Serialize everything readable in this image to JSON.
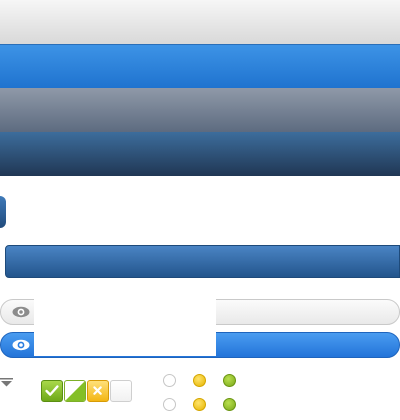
{
  "bars": [
    {
      "name": "light-toolbar"
    },
    {
      "name": "blue-toolbar"
    },
    {
      "name": "gray-toolbar"
    },
    {
      "name": "navy-toolbar"
    }
  ],
  "pills": [
    {
      "state": "default",
      "icon": "eye-icon"
    },
    {
      "state": "active",
      "icon": "eye-icon"
    }
  ],
  "checkboxes": [
    {
      "state": "checked",
      "color": "#7cbf24"
    },
    {
      "state": "partial",
      "color": "#7cbf24"
    },
    {
      "state": "cross",
      "color": "#f2b81b"
    },
    {
      "state": "unchecked",
      "color": "#ffffff"
    }
  ],
  "radios": [
    {
      "state": "unchecked"
    },
    {
      "state": "yellow"
    },
    {
      "state": "green"
    }
  ],
  "colors": {
    "blue": "#2b7fe0",
    "navy": "#23476f",
    "gray": "#6f7b8e",
    "green": "#7cbf24",
    "yellow": "#f2b81b"
  }
}
